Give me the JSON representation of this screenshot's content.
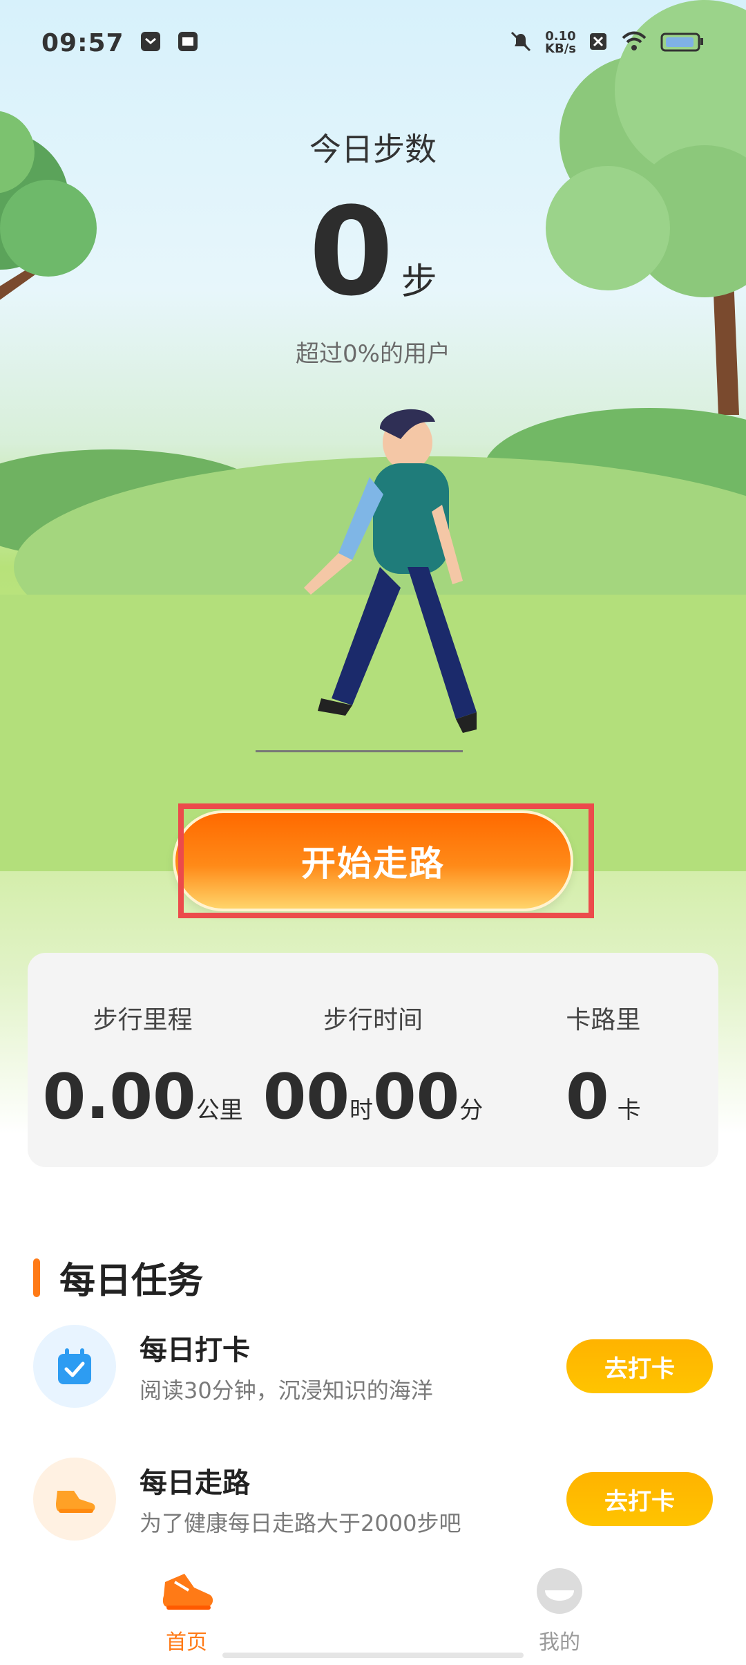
{
  "status": {
    "time": "09:57",
    "net_speed_value": "0.10",
    "net_speed_unit": "KB/s",
    "icons": [
      "notification-icon",
      "sim-icon",
      "mute-icon",
      "close-icon",
      "wifi-icon",
      "battery-icon"
    ]
  },
  "header": {
    "title": "今日步数",
    "steps_value": "0",
    "steps_unit": "步",
    "exceed_text": "超过0%的用户"
  },
  "actions": {
    "start_walk_label": "开始走路"
  },
  "stats": {
    "distance": {
      "label": "步行里程",
      "value": "0.00",
      "unit": "公里"
    },
    "time": {
      "label": "步行时间",
      "hours": "00",
      "hours_unit": "时",
      "minutes": "00",
      "minutes_unit": "分"
    },
    "calories": {
      "label": "卡路里",
      "value": "0",
      "unit": "卡"
    }
  },
  "tasks": {
    "title": "每日任务",
    "items": [
      {
        "title": "每日打卡",
        "desc": "阅读30分钟，沉浸知识的海洋",
        "button": "去打卡",
        "icon": "calendar-check-icon"
      },
      {
        "title": "每日走路",
        "desc": "为了健康每日走路大于2000步吧",
        "button": "去打卡",
        "icon": "shoe-icon"
      }
    ]
  },
  "nav": {
    "home_label": "首页",
    "mine_label": "我的",
    "active_color": "#ff7a16",
    "inactive_color": "#9a9a9a"
  }
}
